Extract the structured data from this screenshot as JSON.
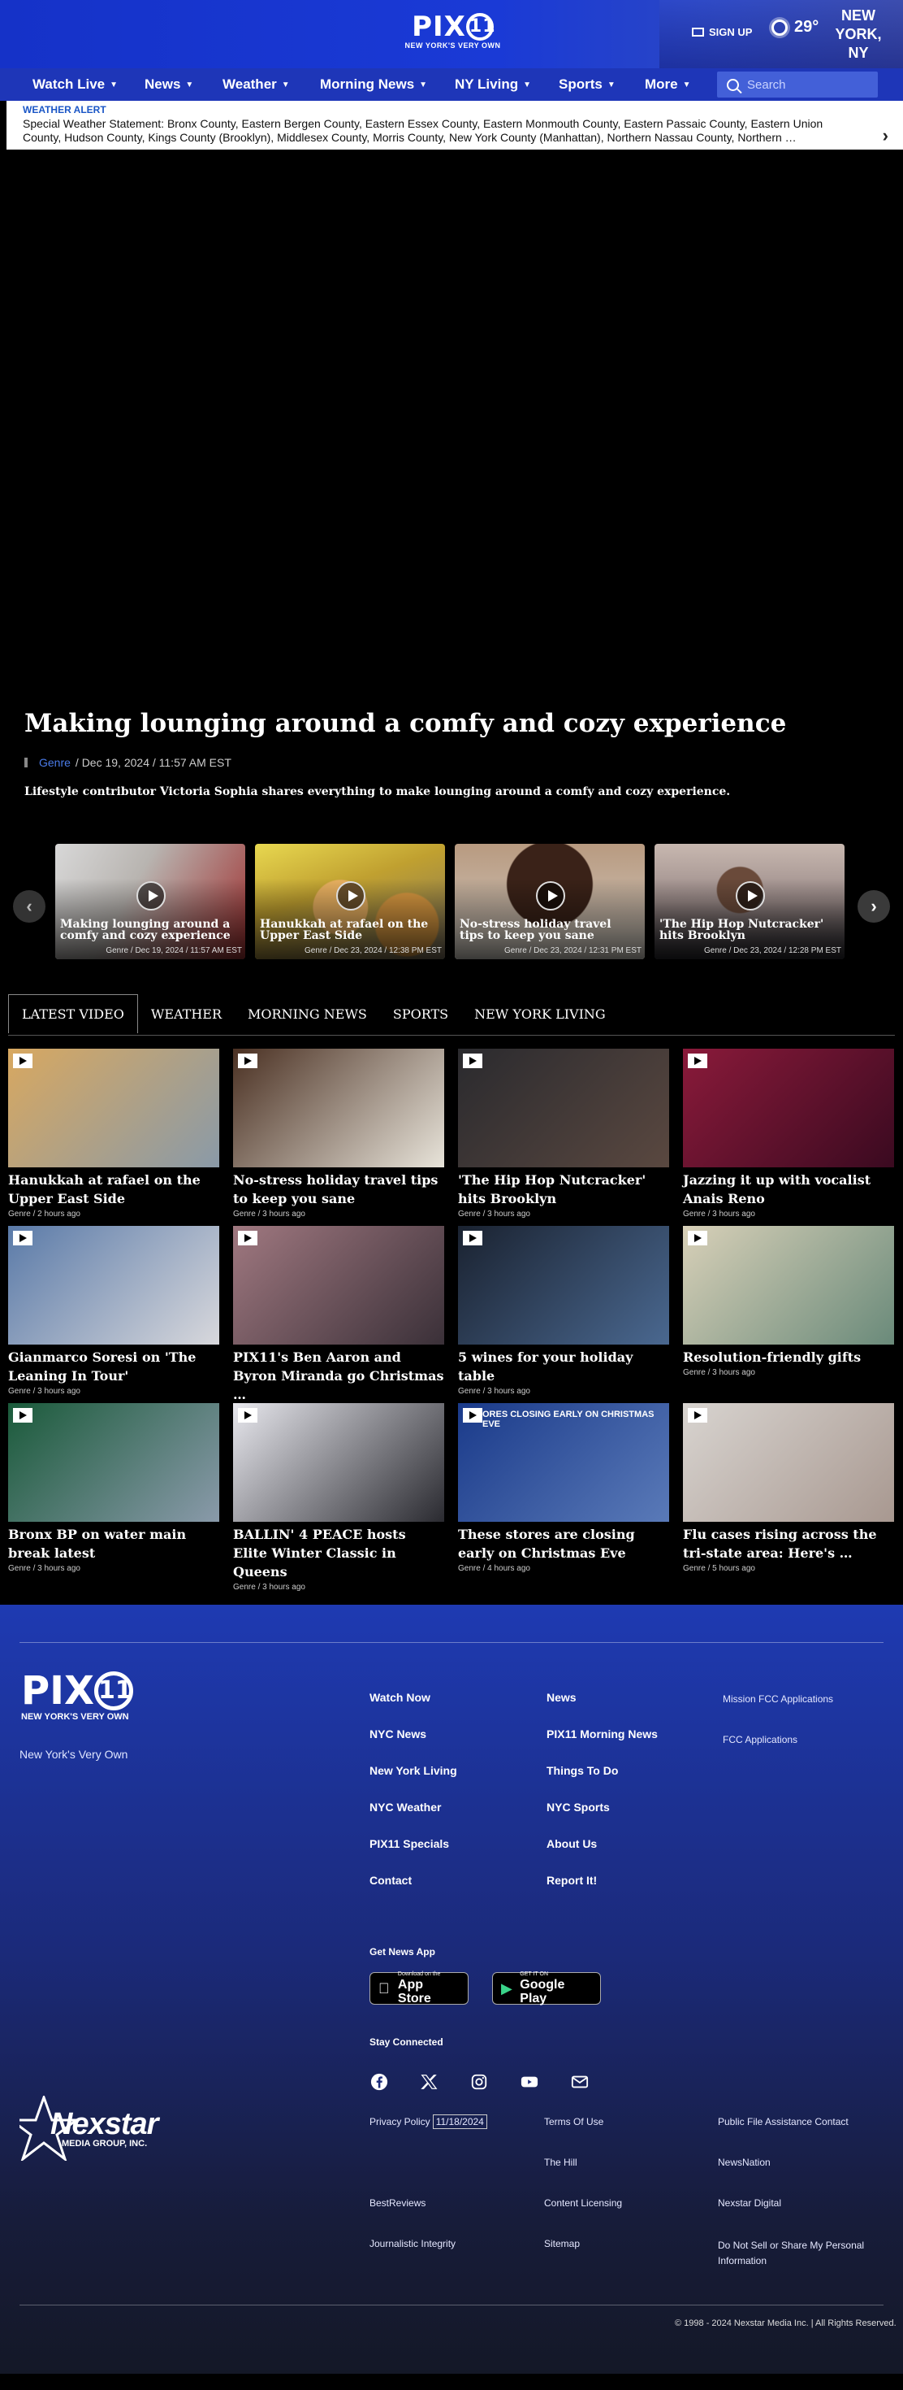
{
  "header": {
    "logo_text": "PIX",
    "logo_num": "11",
    "logo_tag": "NEW YORK'S VERY OWN",
    "signup": "SIGN UP",
    "temp": "29°",
    "location": "NEW YORK, NY"
  },
  "nav": {
    "items": [
      "Watch Live",
      "News",
      "Weather",
      "Morning News",
      "NY Living",
      "Sports",
      "More"
    ],
    "search_placeholder": "Search"
  },
  "alert": {
    "label": "WEATHER ALERT",
    "text": "Special Weather Statement: Bronx County, Eastern Bergen County, Eastern Essex County, Eastern Monmouth County, Eastern Passaic County, Eastern Union County, Hudson County, Kings County (Brooklyn), Middlesex County, Morris County, New York County (Manhattan), Northern Nassau County, Northern …"
  },
  "hero": {
    "title": "Making lounging around a comfy and cozy experience",
    "genre": "Genre",
    "date": "/ Dec 19, 2024 / 11:57 AM EST",
    "description": "Lifestyle contributor Victoria Sophia shares everything to make lounging around a comfy and cozy experience."
  },
  "carousel": [
    {
      "title": "Making lounging around a comfy and cozy experience",
      "meta": "Genre / Dec 19, 2024 / 11:57 AM EST",
      "color": "#7a5a5a"
    },
    {
      "title": "Hanukkah at rafael on the Upper East Side",
      "meta": "Genre / Dec 23, 2024 / 12:38 PM EST",
      "color": "#b89640"
    },
    {
      "title": "No-stress holiday travel tips to keep you sane",
      "meta": "Genre / Dec 23, 2024 / 12:31 PM EST",
      "color": "#6a4a3a"
    },
    {
      "title": "'The Hip Hop Nutcracker' hits Brooklyn",
      "meta": "Genre / Dec 23, 2024 / 12:28 PM EST",
      "color": "#5a5a5a"
    }
  ],
  "tabs": [
    "LATEST VIDEO",
    "WEATHER",
    "MORNING NEWS",
    "SPORTS",
    "NEW YORK LIVING"
  ],
  "videos": [
    {
      "title": "Hanukkah at rafael on the Upper East Side",
      "meta": "Genre / 2 hours ago",
      "c1": "#d8a860",
      "c2": "#8a9aa8"
    },
    {
      "title": "No-stress holiday travel tips to keep you sane",
      "meta": "Genre / 3 hours ago",
      "c1": "#4a3022",
      "c2": "#e8e4da"
    },
    {
      "title": "'The Hip Hop Nutcracker' hits Brooklyn",
      "meta": "Genre / 3 hours ago",
      "c1": "#2a2a2e",
      "c2": "#5a4840"
    },
    {
      "title": "Jazzing it up with vocalist Anais Reno",
      "meta": "Genre / 3 hours ago",
      "c1": "#8a1a3a",
      "c2": "#3a0a20"
    },
    {
      "title": "Gianmarco Soresi on 'The Leaning In Tour'",
      "meta": "Genre / 3 hours ago",
      "c1": "#5a7aa8",
      "c2": "#d8d8dc"
    },
    {
      "title": "PIX11's Ben Aaron and Byron Miranda go Christmas …",
      "meta": "Genre / 3 hours ago",
      "c1": "#a07880",
      "c2": "#3a3038"
    },
    {
      "title": "5 wines for your holiday table",
      "meta": "Genre / 3 hours ago",
      "c1": "#1a2230",
      "c2": "#4a6890"
    },
    {
      "title": "Resolution-friendly gifts",
      "meta": "Genre / 3 hours ago",
      "c1": "#d8d0b8",
      "c2": "#6a8a7a"
    },
    {
      "title": "Bronx BP on water main break latest",
      "meta": "Genre / 3 hours ago",
      "c1": "#1a5a3a",
      "c2": "#8a9aaa"
    },
    {
      "title": "BALLIN' 4 PEACE hosts Elite Winter Classic in Queens",
      "meta": "Genre / 3 hours ago",
      "c1": "#e8e8ee",
      "c2": "#2a2a30"
    },
    {
      "title": "These stores are closing early on Christmas Eve",
      "meta": "Genre / 4 hours ago",
      "c1": "#1a3a8a",
      "c2": "#5a7ab8"
    },
    {
      "title": "Flu cases rising across the tri-state area: Here's …",
      "meta": "Genre / 5 hours ago",
      "c1": "#d8d4d0",
      "c2": "#a89890"
    }
  ],
  "video_label_stores": "ORES CLOSING EARLY ON CHRISTMAS EVE",
  "footer": {
    "slogan": "New York's Very Own",
    "col1": [
      "Watch Now",
      "NYC News",
      "New York Living",
      "NYC Weather",
      "PIX11 Specials",
      "Contact"
    ],
    "col2": [
      "News",
      "PIX11 Morning News",
      "Things To Do",
      "NYC Sports",
      "About Us",
      "Report It!"
    ],
    "col3": [
      "Mission FCC Applications",
      "FCC Applications"
    ],
    "get_app": "Get News App",
    "appstore_small": "Download on the",
    "appstore_big": "App Store",
    "gplay_small": "GET IT ON",
    "gplay_big": "Google Play",
    "stay_connected": "Stay Connected",
    "legal_col1": [
      "Privacy Policy",
      "BestReviews",
      "Journalistic Integrity"
    ],
    "privacy_date": "11/18/2024",
    "legal_col2": [
      "Terms Of Use",
      "The Hill",
      "Content Licensing",
      "Sitemap"
    ],
    "legal_col3": [
      "Public File Assistance Contact",
      "NewsNation",
      "Nexstar Digital",
      "Do Not Sell or Share My Personal Information"
    ],
    "nexstar": "Nexstar",
    "nexstar_group": "MEDIA GROUP, INC.",
    "copyright": "© 1998 - 2024 Nexstar Media Inc. | All Rights Reserved."
  }
}
